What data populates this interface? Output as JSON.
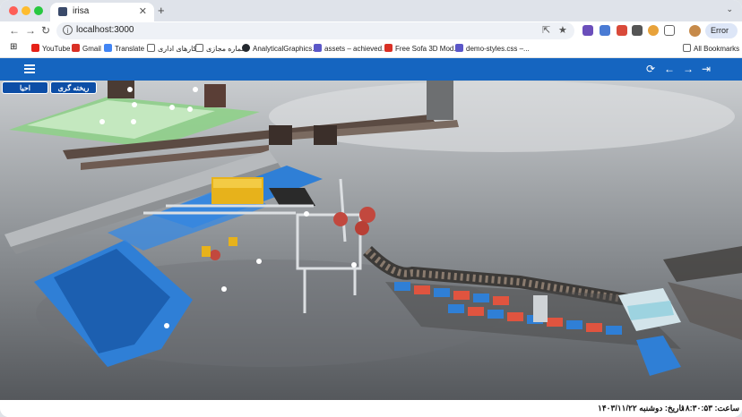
{
  "browser": {
    "tab": {
      "title": "irisa"
    },
    "address": {
      "url": "localhost:3000"
    },
    "error_pill": "Error",
    "bookmarks": [
      {
        "label": "YouTube",
        "color": "#e62117"
      },
      {
        "label": "Gmail",
        "color": "#d93025"
      },
      {
        "label": "Translate",
        "color": "#4285f4"
      },
      {
        "label": "کارهای اداری",
        "color": "#9aa0a6"
      },
      {
        "label": "شماره مجازی",
        "color": "#9aa0a6"
      },
      {
        "label": "AnalyticalGraphics...",
        "color": "#24292f"
      },
      {
        "label": "assets – achieved...",
        "color": "#5b57c8"
      },
      {
        "label": "Free Sofa 3D Mod...",
        "color": "#d93025"
      },
      {
        "label": "demo-styles.css –...",
        "color": "#5b57c8"
      }
    ],
    "all_bookmarks": "All Bookmarks"
  },
  "app": {
    "buttons": {
      "shading": "ریخته گری",
      "revive": "احیا"
    },
    "status": {
      "time": "ساعت: ۱۸:۳۰:۵۳",
      "date": "تاریخ: دوشنبه ۱۴۰۳/۱۱/۲۲"
    },
    "theme": {
      "appbar": "#1565c0",
      "machinery": "#2f7fd6"
    }
  }
}
